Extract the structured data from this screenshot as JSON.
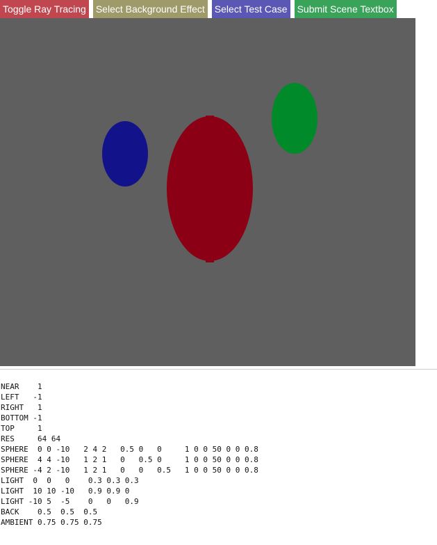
{
  "toolbar": {
    "buttons": [
      {
        "label": "Toggle Ray Tracing",
        "color": "#c0474f"
      },
      {
        "label": "Select Background Effect",
        "color": "#9e9a6a"
      },
      {
        "label": "Select Test Case",
        "color": "#5a58b4"
      },
      {
        "label": "Submit Scene Textbox",
        "color": "#3aa35a"
      }
    ]
  },
  "render": {
    "background_color": "#5f5f5f",
    "resolution": [
      64,
      64
    ],
    "spheres": [
      {
        "label": "red-sphere",
        "color": "#8b0014"
      },
      {
        "label": "blue-sphere",
        "color": "#12128a"
      },
      {
        "label": "green-sphere",
        "color": "#008a2a"
      }
    ]
  },
  "scene_text": "NEAR    1\nLEFT   -1\nRIGHT   1\nBOTTOM -1\nTOP     1\nRES     64 64\nSPHERE  0 0 -10   2 4 2   0.5 0   0     1 0 0 50 0 0 0.8\nSPHERE  4 4 -10   1 2 1   0   0.5 0     1 0 0 50 0 0 0.8\nSPHERE -4 2 -10   1 2 1   0   0   0.5   1 0 0 50 0 0 0.8\nLIGHT  0  0   0    0.3 0.3 0.3\nLIGHT  10 10 -10   0.9 0.9 0\nLIGHT -10 5  -5    0   0   0.9\nBACK    0.5  0.5  0.5\nAMBIENT 0.75 0.75 0.75"
}
